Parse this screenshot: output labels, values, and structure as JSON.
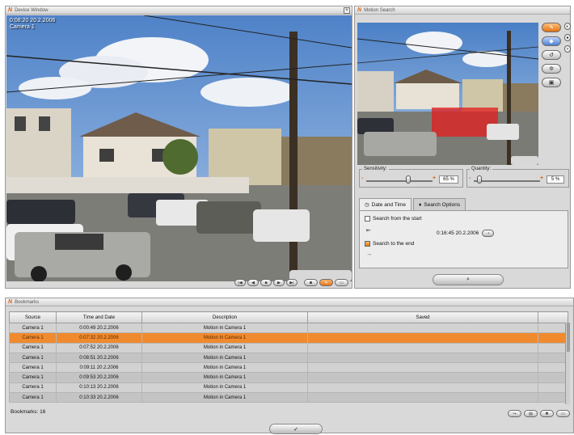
{
  "device_window": {
    "title": "Device Window",
    "timestamp": "0:08:20 20.2.2006",
    "camera": "Camera 1"
  },
  "motion_window": {
    "title": "Motion Search",
    "sensitivity_label": "Sensitivity:",
    "sensitivity_value": "65 %",
    "sensitivity_level": 0.65,
    "quantity_label": "Quantity:",
    "quantity_value": "5 %",
    "quantity_level": 0.05,
    "tab_date": "Date and Time",
    "tab_options": "Search Options",
    "search_from_start": "Search from the start",
    "time_value": "0:16:45 20.2.2006",
    "search_to_end": "Search to the end"
  },
  "bookmarks": {
    "title": "Bookmarks",
    "columns": [
      "Source",
      "Time and Date",
      "Description",
      "Saved"
    ],
    "rows": [
      [
        "Camera 1",
        "0:00:49 20.2.2006",
        "Motion in Camera 1",
        ""
      ],
      [
        "Camera 1",
        "0:07:32 20.2.2006",
        "Motion in Camera 1",
        ""
      ],
      [
        "Camera 1",
        "0:07:52 20.2.2006",
        "Motion in Camera 1",
        ""
      ],
      [
        "Camera 1",
        "0:08:51 20.2.2006",
        "Motion in Camera 1",
        ""
      ],
      [
        "Camera 1",
        "0:09:11 20.2.2006",
        "Motion in Camera 1",
        ""
      ],
      [
        "Camera 1",
        "0:09:53 20.2.2006",
        "Motion in Camera 1",
        ""
      ],
      [
        "Camera 1",
        "0:10:13 20.2.2006",
        "Motion in Camera 1",
        ""
      ],
      [
        "Camera 1",
        "0:10:33 20.2.2006",
        "Motion in Camera 1",
        ""
      ]
    ],
    "selected_row": 1,
    "count_label": "Bookmarks: 16"
  },
  "colors": {
    "accent": "#f08a2e",
    "logo": "#d9601a",
    "motion_region": "#e02020"
  }
}
